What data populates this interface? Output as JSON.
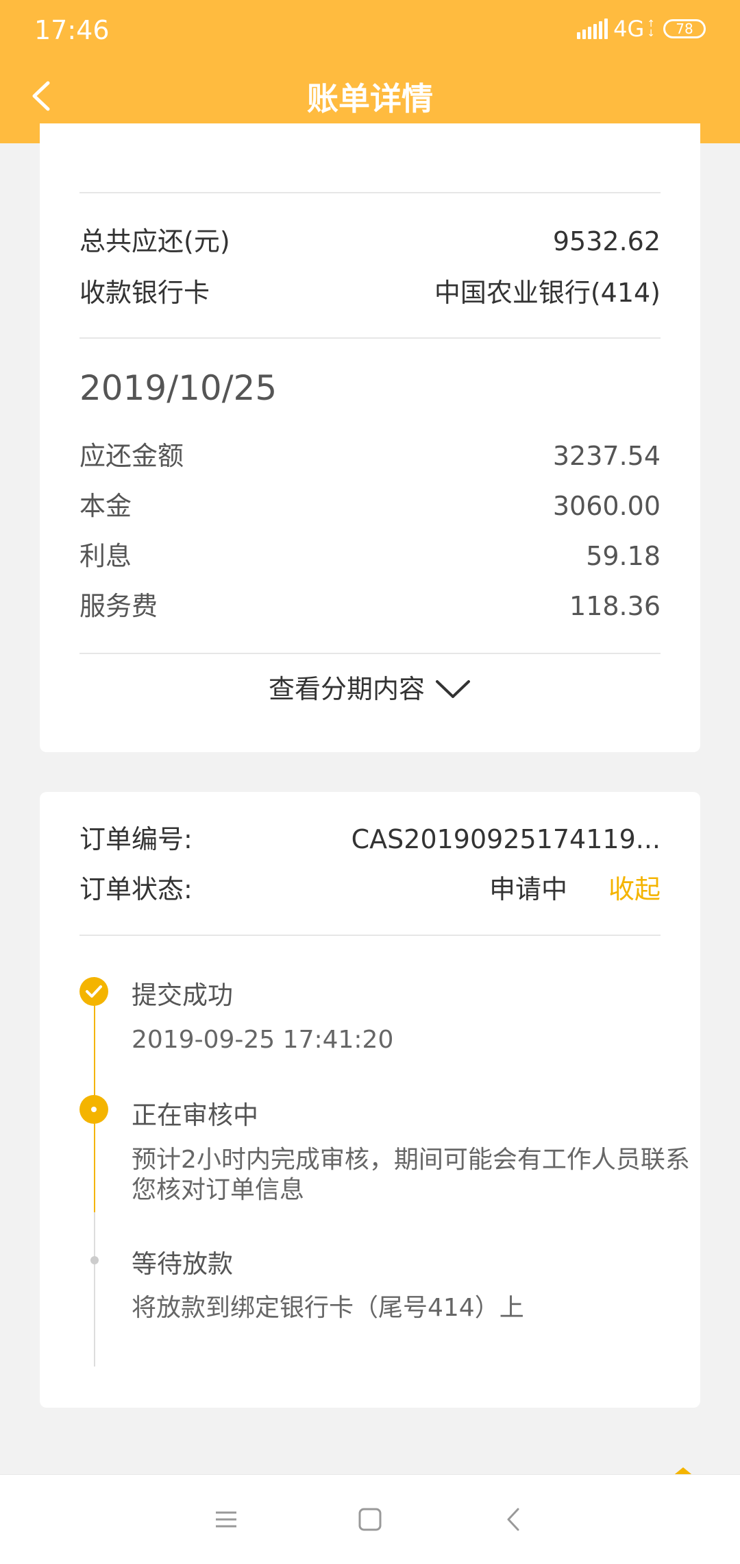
{
  "status_bar": {
    "time": "17:46",
    "network": "4G",
    "battery": "78"
  },
  "header": {
    "title": "账单详情"
  },
  "summary": {
    "total_label": "总共应还(元)",
    "total_value": "9532.62",
    "card_label": "收款银行卡",
    "card_value": "中国农业银行(414)"
  },
  "installment": {
    "date": "2019/10/25",
    "items": [
      {
        "label": "应还金额",
        "value": "3237.54"
      },
      {
        "label": "本金",
        "value": "3060.00"
      },
      {
        "label": "利息",
        "value": "59.18"
      },
      {
        "label": "服务费",
        "value": "118.36"
      }
    ],
    "expand_label": "查看分期内容"
  },
  "order": {
    "number_label": "订单编号:",
    "number_value": "CAS20190925174119...",
    "status_label": "订单状态:",
    "status_value": "申请中",
    "collapse_label": "收起"
  },
  "timeline": [
    {
      "title": "提交成功",
      "text": "2019-09-25 17:41:20"
    },
    {
      "title": "正在审核中",
      "text": "预计2小时内完成审核，期间可能会有工作人员联系您核对订单信息"
    },
    {
      "title": "等待放款",
      "text": "将放款到绑定银行卡（尾号414）上"
    }
  ],
  "colors": {
    "header": "#ffbb3f",
    "accent": "#f4b400"
  },
  "icons": [
    "back-icon",
    "check-icon",
    "chevron-down-icon",
    "menu-icon",
    "home-icon",
    "nav-back-icon"
  ]
}
